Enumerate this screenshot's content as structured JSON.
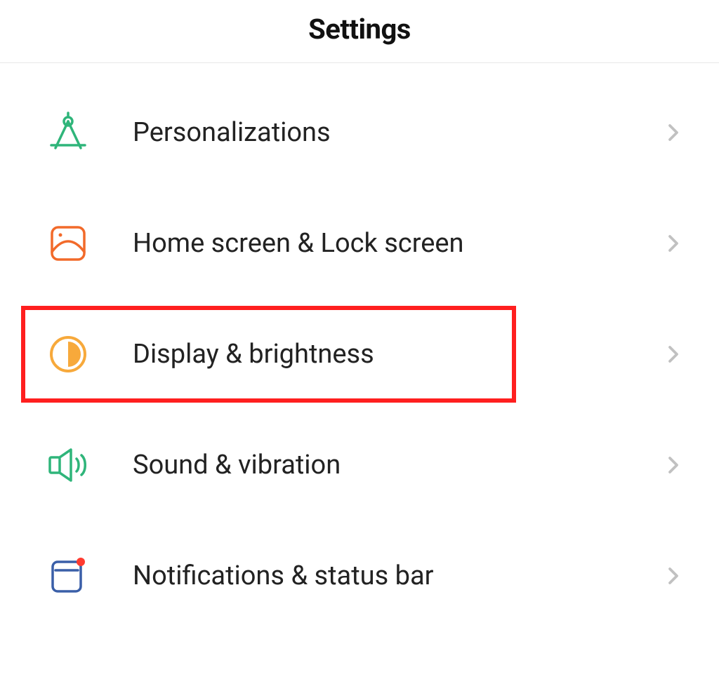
{
  "header": {
    "title": "Settings"
  },
  "menu": {
    "items": [
      {
        "id": "personalizations",
        "label": "Personalizations",
        "icon": "compass-icon",
        "highlight": false
      },
      {
        "id": "home_lock",
        "label": "Home screen & Lock screen",
        "icon": "wallpaper-icon",
        "highlight": false
      },
      {
        "id": "display_brightness",
        "label": "Display & brightness",
        "icon": "brightness-icon",
        "highlight": true
      },
      {
        "id": "sound_vibration",
        "label": "Sound & vibration",
        "icon": "sound-icon",
        "highlight": false
      },
      {
        "id": "notifications_statusbar",
        "label": "Notifications & status bar",
        "icon": "notification-icon",
        "highlight": false
      }
    ]
  },
  "colors": {
    "highlight_border": "#ff1f1f",
    "icon_green": "#2fb57a",
    "icon_orange": "#f26a2a",
    "icon_amber": "#f7a93b",
    "icon_blue": "#3a5fa8",
    "chevron": "#c1c1c1"
  }
}
